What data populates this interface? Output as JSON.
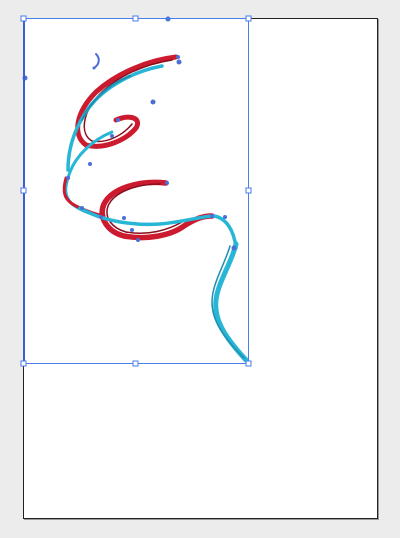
{
  "canvas": {
    "selection_color": "#4a7ee8",
    "artboard_fill": "#ffffff",
    "artboard_border": "#222222",
    "pasteboard_color": "#ececec"
  },
  "artwork": {
    "stroke_colors": {
      "red": "#cc1a2e",
      "dark_red": "#8a0f1f",
      "cyan": "#27b6d6",
      "teal": "#1e8fb0",
      "blue_outline": "#4a6fd6"
    },
    "selected": true
  }
}
